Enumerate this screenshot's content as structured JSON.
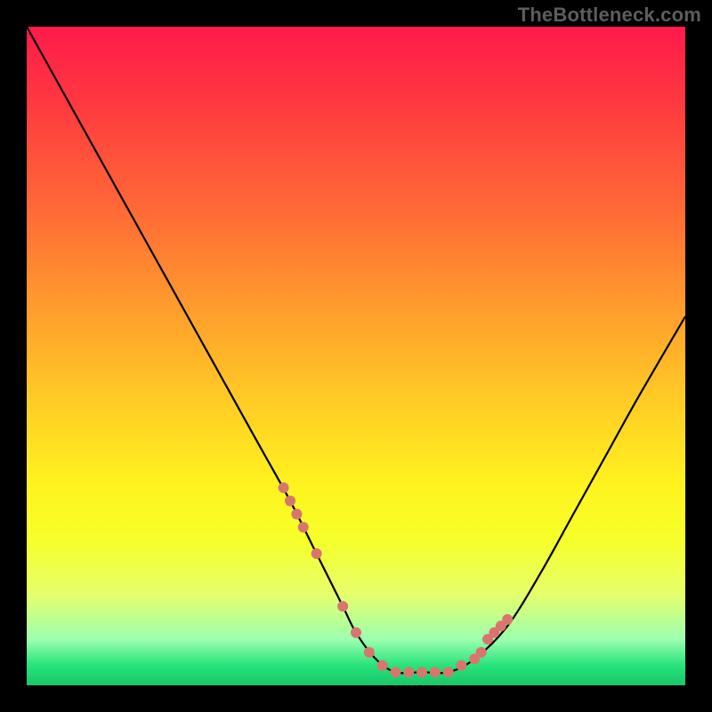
{
  "watermark": "TheBottleneck.com",
  "chart_data": {
    "type": "line",
    "title": "",
    "xlabel": "",
    "ylabel": "",
    "xlim": [
      0,
      100
    ],
    "ylim": [
      0,
      100
    ],
    "grid": false,
    "legend": false,
    "series": [
      {
        "name": "curve",
        "x": [
          0,
          5,
          10,
          15,
          20,
          25,
          30,
          35,
          40,
          44,
          48,
          50,
          53,
          56,
          60,
          64,
          68,
          73,
          78,
          83,
          88,
          93,
          100
        ],
        "values": [
          100,
          91,
          82,
          73,
          64,
          55,
          46,
          37,
          28,
          20,
          12,
          8,
          4,
          2,
          2,
          2,
          4,
          9,
          17,
          26,
          35,
          44,
          56
        ]
      }
    ],
    "markers": {
      "name": "highlighted-points",
      "x": [
        39,
        40,
        41,
        42,
        44,
        48,
        50,
        52,
        54,
        56,
        58,
        60,
        62,
        64,
        66,
        68,
        69,
        70,
        71,
        72,
        73
      ],
      "values": [
        30,
        28,
        26,
        24,
        20,
        12,
        8,
        5,
        3,
        2,
        2,
        2,
        2,
        2,
        3,
        4,
        5,
        7,
        8,
        9,
        10
      ]
    }
  }
}
